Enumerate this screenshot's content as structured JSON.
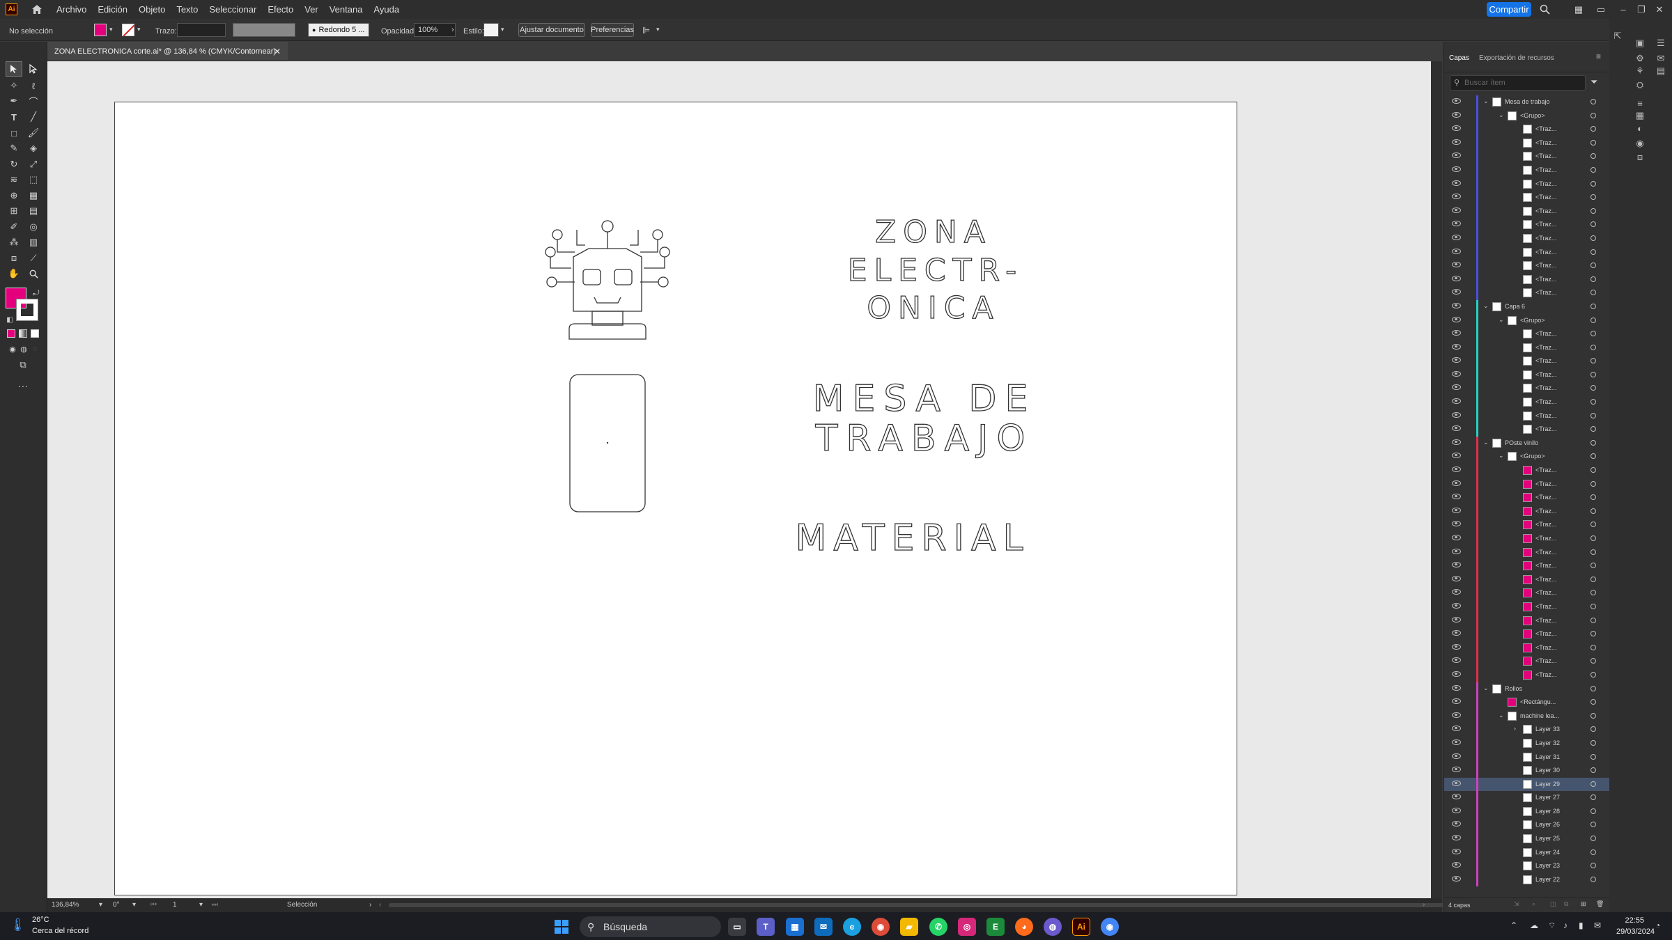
{
  "app": {
    "logo": "Ai",
    "share_label": "Compartir"
  },
  "menu": [
    "Archivo",
    "Edición",
    "Objeto",
    "Texto",
    "Seleccionar",
    "Efecto",
    "Ver",
    "Ventana",
    "Ayuda"
  ],
  "control_bar": {
    "selection_label": "No selección",
    "stroke_label": "Trazo:",
    "brush_label": "Redondo 5 ...",
    "opacity_label": "Opacidad:",
    "opacity_value": "100%",
    "style_label": "Estilo:",
    "fit_doc_button": "Ajustar documento",
    "prefs_button": "Preferencias"
  },
  "document": {
    "tab_title": "ZONA ELECTRONICA corte.ai* @ 136,84 % (CMYK/Contornear)"
  },
  "artwork": {
    "title_lines": [
      "ZONA",
      "ELECTR-",
      "ONICA"
    ],
    "workbench_lines": [
      "MESA DE",
      "TRABAJO"
    ],
    "material_text": "MATERIAL"
  },
  "status": {
    "zoom": "136,84%",
    "rotation": "0°",
    "artboard": "1",
    "tool": "Selección"
  },
  "panel": {
    "tabs": [
      "Capas",
      "Exportación de recursos"
    ],
    "search_placeholder": "Buscar ítem",
    "footer": "4 capas",
    "layers": [
      {
        "name": "Mesa de trabajo",
        "depth": 0,
        "arrow": "v",
        "color": "#4a4fe0",
        "thumb": "#fff",
        "sel": false
      },
      {
        "name": "<Grupo>",
        "depth": 1,
        "arrow": "v",
        "color": "#4a4fe0",
        "thumb": "#fff",
        "sel": false
      },
      {
        "name": "<Traz...",
        "depth": 2,
        "arrow": "",
        "color": "#4a4fe0",
        "thumb": "#fff",
        "sel": false
      },
      {
        "name": "<Traz...",
        "depth": 2,
        "arrow": "",
        "color": "#4a4fe0",
        "thumb": "#fff",
        "sel": false
      },
      {
        "name": "<Traz...",
        "depth": 2,
        "arrow": "",
        "color": "#4a4fe0",
        "thumb": "#fff",
        "sel": false
      },
      {
        "name": "<Traz...",
        "depth": 2,
        "arrow": "",
        "color": "#4a4fe0",
        "thumb": "#fff",
        "sel": false
      },
      {
        "name": "<Traz...",
        "depth": 2,
        "arrow": "",
        "color": "#4a4fe0",
        "thumb": "#fff",
        "sel": false
      },
      {
        "name": "<Traz...",
        "depth": 2,
        "arrow": "",
        "color": "#4a4fe0",
        "thumb": "#fff",
        "sel": false
      },
      {
        "name": "<Traz...",
        "depth": 2,
        "arrow": "",
        "color": "#4a4fe0",
        "thumb": "#fff",
        "sel": false
      },
      {
        "name": "<Traz...",
        "depth": 2,
        "arrow": "",
        "color": "#4a4fe0",
        "thumb": "#fff",
        "sel": false
      },
      {
        "name": "<Traz...",
        "depth": 2,
        "arrow": "",
        "color": "#4a4fe0",
        "thumb": "#fff",
        "sel": false
      },
      {
        "name": "<Traz...",
        "depth": 2,
        "arrow": "",
        "color": "#4a4fe0",
        "thumb": "#fff",
        "sel": false
      },
      {
        "name": "<Traz...",
        "depth": 2,
        "arrow": "",
        "color": "#4a4fe0",
        "thumb": "#fff",
        "sel": false
      },
      {
        "name": "<Traz...",
        "depth": 2,
        "arrow": "",
        "color": "#4a4fe0",
        "thumb": "#fff",
        "sel": false
      },
      {
        "name": "<Traz...",
        "depth": 2,
        "arrow": "",
        "color": "#4a4fe0",
        "thumb": "#fff",
        "sel": false
      },
      {
        "name": "Capa 6",
        "depth": 0,
        "arrow": "v",
        "color": "#22d3c5",
        "thumb": "#fff",
        "sel": false
      },
      {
        "name": "<Grupo>",
        "depth": 1,
        "arrow": "v",
        "color": "#22d3c5",
        "thumb": "#fff",
        "sel": false
      },
      {
        "name": "<Traz...",
        "depth": 2,
        "arrow": "",
        "color": "#22d3c5",
        "thumb": "#fff",
        "sel": false
      },
      {
        "name": "<Traz...",
        "depth": 2,
        "arrow": "",
        "color": "#22d3c5",
        "thumb": "#fff",
        "sel": false
      },
      {
        "name": "<Traz...",
        "depth": 2,
        "arrow": "",
        "color": "#22d3c5",
        "thumb": "#fff",
        "sel": false
      },
      {
        "name": "<Traz...",
        "depth": 2,
        "arrow": "",
        "color": "#22d3c5",
        "thumb": "#fff",
        "sel": false
      },
      {
        "name": "<Traz...",
        "depth": 2,
        "arrow": "",
        "color": "#22d3c5",
        "thumb": "#fff",
        "sel": false
      },
      {
        "name": "<Traz...",
        "depth": 2,
        "arrow": "",
        "color": "#22d3c5",
        "thumb": "#fff",
        "sel": false
      },
      {
        "name": "<Traz...",
        "depth": 2,
        "arrow": "",
        "color": "#22d3c5",
        "thumb": "#fff",
        "sel": false
      },
      {
        "name": "<Traz...",
        "depth": 2,
        "arrow": "",
        "color": "#22d3c5",
        "thumb": "#fff",
        "sel": false
      },
      {
        "name": "POste vinilo",
        "depth": 0,
        "arrow": "v",
        "color": "#e0304a",
        "thumb": "#fff",
        "sel": false
      },
      {
        "name": "<Grupo>",
        "depth": 1,
        "arrow": "v",
        "color": "#e0304a",
        "thumb": "#fff",
        "sel": false
      },
      {
        "name": "<Traz...",
        "depth": 2,
        "arrow": "",
        "color": "#e0304a",
        "thumb": "#e4007c",
        "sel": false
      },
      {
        "name": "<Traz...",
        "depth": 2,
        "arrow": "",
        "color": "#e0304a",
        "thumb": "#e4007c",
        "sel": false
      },
      {
        "name": "<Traz...",
        "depth": 2,
        "arrow": "",
        "color": "#e0304a",
        "thumb": "#e4007c",
        "sel": false
      },
      {
        "name": "<Traz...",
        "depth": 2,
        "arrow": "",
        "color": "#e0304a",
        "thumb": "#e4007c",
        "sel": false
      },
      {
        "name": "<Traz...",
        "depth": 2,
        "arrow": "",
        "color": "#e0304a",
        "thumb": "#e4007c",
        "sel": false
      },
      {
        "name": "<Traz...",
        "depth": 2,
        "arrow": "",
        "color": "#e0304a",
        "thumb": "#e4007c",
        "sel": false
      },
      {
        "name": "<Traz...",
        "depth": 2,
        "arrow": "",
        "color": "#e0304a",
        "thumb": "#e4007c",
        "sel": false
      },
      {
        "name": "<Traz...",
        "depth": 2,
        "arrow": "",
        "color": "#e0304a",
        "thumb": "#e4007c",
        "sel": false
      },
      {
        "name": "<Traz...",
        "depth": 2,
        "arrow": "",
        "color": "#e0304a",
        "thumb": "#e4007c",
        "sel": false
      },
      {
        "name": "<Traz...",
        "depth": 2,
        "arrow": "",
        "color": "#e0304a",
        "thumb": "#e4007c",
        "sel": false
      },
      {
        "name": "<Traz...",
        "depth": 2,
        "arrow": "",
        "color": "#e0304a",
        "thumb": "#e4007c",
        "sel": false
      },
      {
        "name": "<Traz...",
        "depth": 2,
        "arrow": "",
        "color": "#e0304a",
        "thumb": "#e4007c",
        "sel": false
      },
      {
        "name": "<Traz...",
        "depth": 2,
        "arrow": "",
        "color": "#e0304a",
        "thumb": "#e4007c",
        "sel": false
      },
      {
        "name": "<Traz...",
        "depth": 2,
        "arrow": "",
        "color": "#e0304a",
        "thumb": "#e4007c",
        "sel": false
      },
      {
        "name": "<Traz...",
        "depth": 2,
        "arrow": "",
        "color": "#e0304a",
        "thumb": "#e4007c",
        "sel": false
      },
      {
        "name": "<Traz...",
        "depth": 2,
        "arrow": "",
        "color": "#e0304a",
        "thumb": "#e4007c",
        "sel": false
      },
      {
        "name": "Rollos",
        "depth": 0,
        "arrow": "v",
        "color": "#d040c0",
        "thumb": "#fff",
        "sel": false
      },
      {
        "name": "<Rectángu...",
        "depth": 1,
        "arrow": "",
        "color": "#d040c0",
        "thumb": "#e4007c",
        "sel": false
      },
      {
        "name": "machine lea...",
        "depth": 1,
        "arrow": "v",
        "color": "#d040c0",
        "thumb": "#fff",
        "sel": false
      },
      {
        "name": "Layer 33",
        "depth": 2,
        "arrow": ">",
        "color": "#d040c0",
        "thumb": "#fff",
        "sel": false
      },
      {
        "name": "Layer 32",
        "depth": 2,
        "arrow": "",
        "color": "#d040c0",
        "thumb": "#fff",
        "sel": false
      },
      {
        "name": "Layer 31",
        "depth": 2,
        "arrow": "",
        "color": "#d040c0",
        "thumb": "#fff",
        "sel": false
      },
      {
        "name": "Layer 30",
        "depth": 2,
        "arrow": "",
        "color": "#d040c0",
        "thumb": "#fff",
        "sel": false
      },
      {
        "name": "Layer 29",
        "depth": 2,
        "arrow": "",
        "color": "#d040c0",
        "thumb": "#fff",
        "sel": true
      },
      {
        "name": "Layer 27",
        "depth": 2,
        "arrow": "",
        "color": "#d040c0",
        "thumb": "#fff",
        "sel": false
      },
      {
        "name": "Layer 28",
        "depth": 2,
        "arrow": "",
        "color": "#d040c0",
        "thumb": "#fff",
        "sel": false
      },
      {
        "name": "Layer 26",
        "depth": 2,
        "arrow": "",
        "color": "#d040c0",
        "thumb": "#fff",
        "sel": false
      },
      {
        "name": "Layer 25",
        "depth": 2,
        "arrow": "",
        "color": "#d040c0",
        "thumb": "#fff",
        "sel": false
      },
      {
        "name": "Layer 24",
        "depth": 2,
        "arrow": "",
        "color": "#d040c0",
        "thumb": "#fff",
        "sel": false
      },
      {
        "name": "Layer 23",
        "depth": 2,
        "arrow": "",
        "color": "#d040c0",
        "thumb": "#fff",
        "sel": false
      },
      {
        "name": "Layer 22",
        "depth": 2,
        "arrow": "",
        "color": "#d040c0",
        "thumb": "#fff",
        "sel": false
      }
    ]
  },
  "taskbar": {
    "weather_temp": "26°C",
    "weather_desc": "Cerca del récord",
    "search_placeholder": "Búsqueda",
    "time": "22:55",
    "date": "29/03/2024"
  },
  "colors": {
    "fill": "#e4007c",
    "accent": "#1473e6"
  }
}
